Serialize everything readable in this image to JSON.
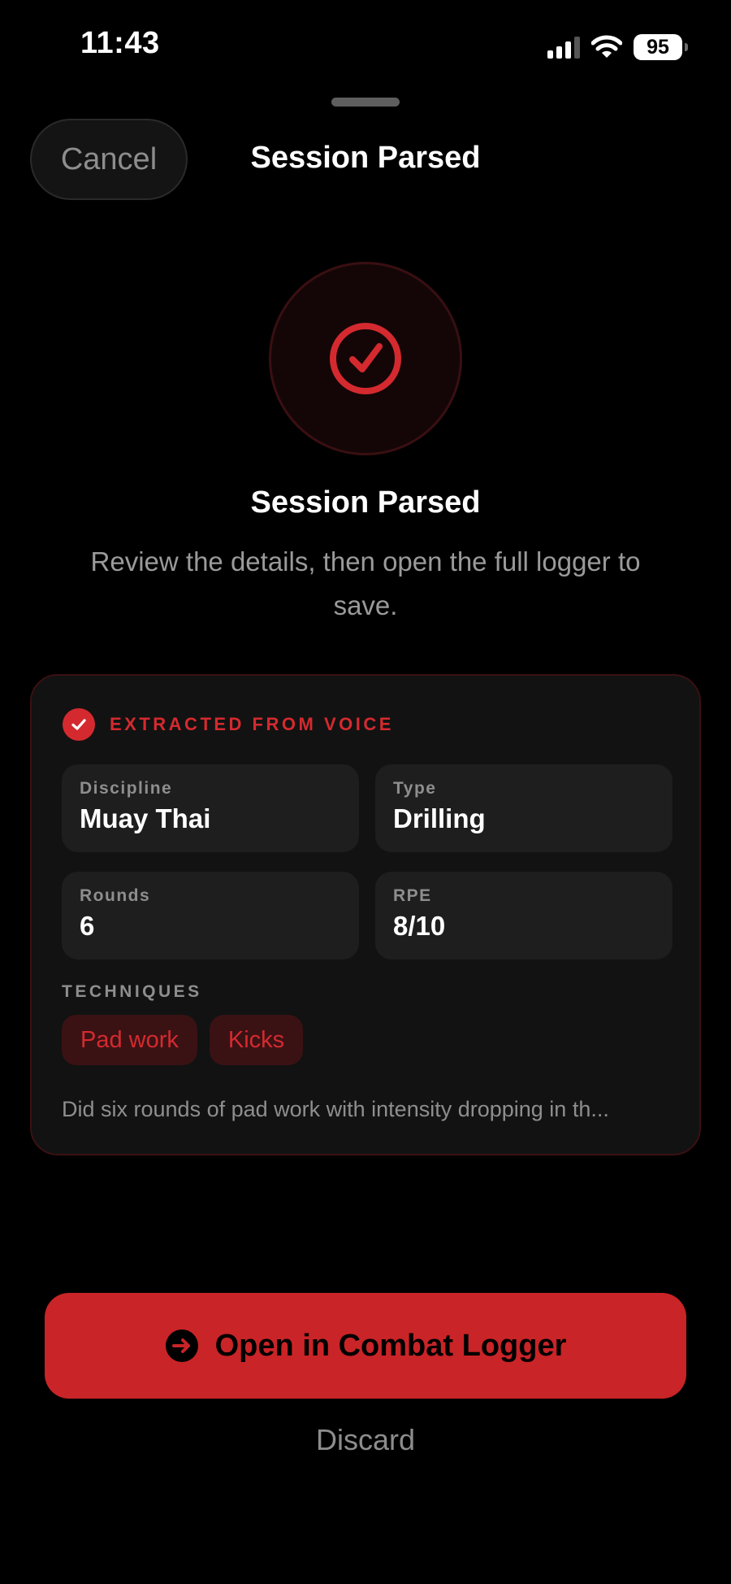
{
  "status_bar": {
    "time": "11:43",
    "battery": "95",
    "icons": [
      "cellular-signal-icon",
      "wifi-icon",
      "battery-icon"
    ]
  },
  "nav": {
    "cancel_label": "Cancel",
    "title": "Session Parsed"
  },
  "hero": {
    "icon": "check-circle-icon",
    "title": "Session Parsed",
    "subtitle": "Review the details, then open the full logger to save."
  },
  "card": {
    "header_label": "EXTRACTED FROM VOICE",
    "fields": [
      {
        "label": "Discipline",
        "value": "Muay Thai"
      },
      {
        "label": "Type",
        "value": "Drilling"
      },
      {
        "label": "Rounds",
        "value": "6"
      },
      {
        "label": "RPE",
        "value": "8/10"
      }
    ],
    "techniques_label": "TECHNIQUES",
    "techniques": [
      "Pad work",
      "Kicks"
    ],
    "transcript": "Did six rounds of pad work with intensity dropping in th..."
  },
  "actions": {
    "primary_label": "Open in Combat Logger",
    "primary_icon": "arrow-right-circle-icon",
    "discard_label": "Discard"
  },
  "colors": {
    "accent": "#d42a2f",
    "primary_button": "#c92427",
    "background": "#000000",
    "card": "#121212",
    "field": "#1e1e1e"
  }
}
